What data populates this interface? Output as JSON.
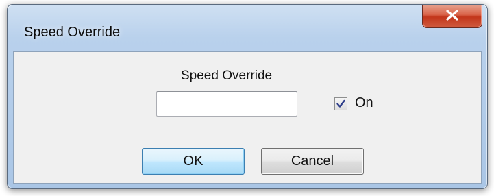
{
  "window": {
    "title": "Speed Override"
  },
  "form": {
    "field_label": "Speed Override",
    "speed_value": "",
    "checkbox_label": "On",
    "checkbox_checked": true
  },
  "buttons": {
    "ok_label": "OK",
    "cancel_label": "Cancel"
  },
  "icons": {
    "close": "close-icon",
    "check": "checkmark-icon"
  },
  "colors": {
    "titlebar": "#b9d1ec",
    "close_button": "#c2361b",
    "dialog_body": "#f0f0f0",
    "default_button": "#bee6fd"
  }
}
